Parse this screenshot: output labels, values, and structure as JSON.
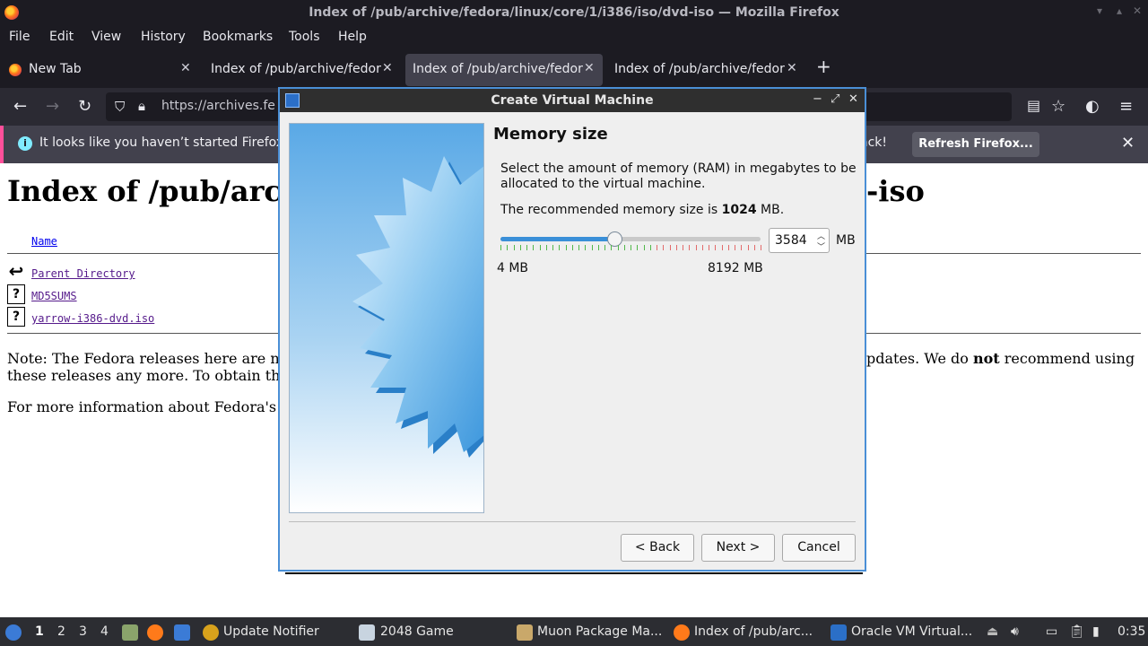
{
  "window": {
    "title": "Index of /pub/archive/fedora/linux/core/1/i386/iso/dvd-iso — Mozilla Firefox"
  },
  "menu": [
    "File",
    "Edit",
    "View",
    "History",
    "Bookmarks",
    "Tools",
    "Help"
  ],
  "tabs": [
    {
      "label": "New Tab",
      "close": "✕"
    },
    {
      "label": "Index of /pub/archive/fedora",
      "close": "✕"
    },
    {
      "label": "Index of /pub/archive/fedora",
      "close": "✕"
    },
    {
      "label": "Index of /pub/archive/fedora",
      "close": "✕"
    }
  ],
  "newtab_label": "+",
  "url": "https://archives.fe",
  "notification": {
    "text": "It looks like you haven’t started Firefox",
    "text_end": "ack!",
    "button": "Refresh Firefox...",
    "close": "✕"
  },
  "page": {
    "heading_left": "Index of /pub/arc",
    "heading_right": "-iso",
    "name_header": "Name",
    "files": [
      {
        "icon": "back-arrow-icon",
        "glyph": "↩",
        "name": "Parent Directory"
      },
      {
        "icon": "unknown-file-icon",
        "glyph": "?",
        "name": "MD5SUMS"
      },
      {
        "icon": "unknown-file-icon",
        "glyph": "?",
        "name": "yarrow-i386-dvd.iso"
      }
    ],
    "note_line1_left": "Note: The Fedora releases here are n",
    "note_line1_right_pre": "pdates. We do ",
    "note_line1_right_bold": "not",
    "note_line1_right_post": " recommend using",
    "note_line2_left": "these releases any more. To obtain th",
    "more_info": "For more information about Fedora's"
  },
  "dialog": {
    "title": "Create Virtual Machine",
    "heading": "Memory size",
    "description": "Select the amount of memory (RAM) in megabytes to be allocated to the virtual machine.",
    "recommend_pre": "The recommended memory size is ",
    "recommend_value": "1024",
    "recommend_post": " MB.",
    "memory": {
      "value": 3584,
      "min": 4,
      "max": 8192,
      "unit": "MB"
    },
    "value_text": "3584",
    "min_label": "4 MB",
    "max_label": "8192 MB",
    "unit_label": "MB",
    "buttons": {
      "back": "< Back",
      "next": "Next >",
      "cancel": "Cancel"
    },
    "colors": {
      "slider_fill": "#3a8fd8",
      "tick_ok": "#52b84a",
      "tick_warn": "#e36b6b",
      "border": "#4a8fd6"
    }
  },
  "taskbar": {
    "workspaces": [
      "1",
      "2",
      "3",
      "4"
    ],
    "apps": [
      {
        "label": "Update Notifier",
        "icon": "update-notifier-icon"
      },
      {
        "label": "2048 Game",
        "icon": "game-icon"
      },
      {
        "label": "Muon Package Ma...",
        "icon": "package-manager-icon"
      },
      {
        "label": "Index of /pub/arc...",
        "icon": "firefox-icon"
      },
      {
        "label": "Oracle VM Virtual...",
        "icon": "virtualbox-icon"
      }
    ],
    "clock": "0:35"
  }
}
